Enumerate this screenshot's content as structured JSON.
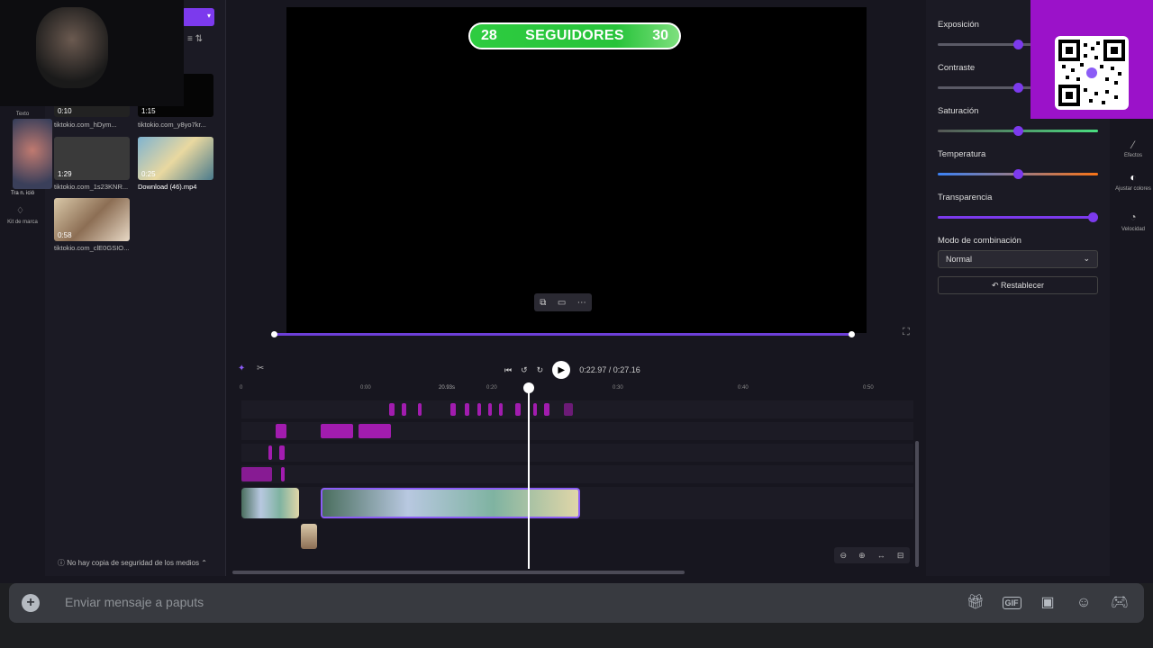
{
  "chat": {
    "placeholder": "Enviar mensaje a paputs",
    "plus_icon": "+",
    "gift_icon": "gift",
    "gif_label": "GIF",
    "sticker_icon": "sticker",
    "emoji_icon": "emoji",
    "game_icon": "gamepad"
  },
  "overlay": {
    "followers_current": "28",
    "followers_label": "SEGUIDORES",
    "followers_goal": "30"
  },
  "editor": {
    "media": [
      {
        "duration": "0:10",
        "name": "tiktokio.com_hDym..."
      },
      {
        "duration": "1:15",
        "name": "tiktokio.com_y8yo7kr..."
      },
      {
        "duration": "1:29",
        "name": "tiktokio.com_1s23KNR..."
      },
      {
        "duration": "0:25",
        "name": "Download (46).mp4"
      },
      {
        "duration": "0:58",
        "name": "tiktokio.com_clE0GSIO..."
      }
    ],
    "rail_labels": {
      "text": "Texto",
      "transitions": "Tra n. ició",
      "brand": "Kit de marca"
    },
    "backup_notice": "No hay copia de seguridad de los medios",
    "time_current": "0:22.97",
    "time_total": "0:27.16",
    "ruler": [
      "0",
      "0:00",
      "20.93s",
      "0:20",
      "0:30",
      "0:40",
      "0:50"
    ],
    "props": {
      "exposure": "Exposición",
      "contrast": "Contraste",
      "saturation": "Saturación",
      "temperature": "Temperatura",
      "transparency": "Transparencia",
      "blend_mode_label": "Modo de combinación",
      "blend_mode_value": "Normal",
      "reset": "Restablecer"
    },
    "right_rail": {
      "effects": "Efectos",
      "adjust": "Ajustar colores",
      "speed": "Velocidad"
    },
    "slider_values": {
      "exposure": 0.5,
      "contrast": 0.5,
      "saturation": 0.5,
      "temperature": 0.5,
      "transparency": 1.0
    }
  }
}
